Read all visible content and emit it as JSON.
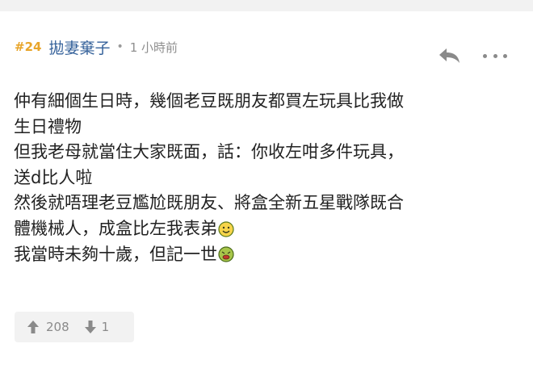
{
  "post": {
    "floor": "#24",
    "author": "拋妻棄子",
    "separator": "•",
    "time": "1 小時前",
    "content_lines": [
      {
        "text": "仲有細個生日時，幾個老豆既朋友都買左玩具比我做"
      },
      {
        "text": "生日禮物"
      },
      {
        "text": "但我老母就當住大家既面，話：你收左咁多件玩具，"
      },
      {
        "text": "送d比人啦"
      },
      {
        "text": "然後就唔理老豆尷尬既朋友、將盒全新五星戰隊既合"
      },
      {
        "text": "體機械人，成盒比左我表弟",
        "emoji": "smile-emoji"
      },
      {
        "text": "我當時未夠十歲，但記一世",
        "emoji": "sick-emoji"
      }
    ]
  },
  "actions": {
    "reply_icon": "reply-icon",
    "more_icon": "more-icon"
  },
  "votes": {
    "upvotes": "208",
    "downvotes": "1"
  },
  "colors": {
    "floor": "#e8a52a",
    "author": "#34619a",
    "text": "#222222",
    "muted": "#8a8a8a"
  }
}
